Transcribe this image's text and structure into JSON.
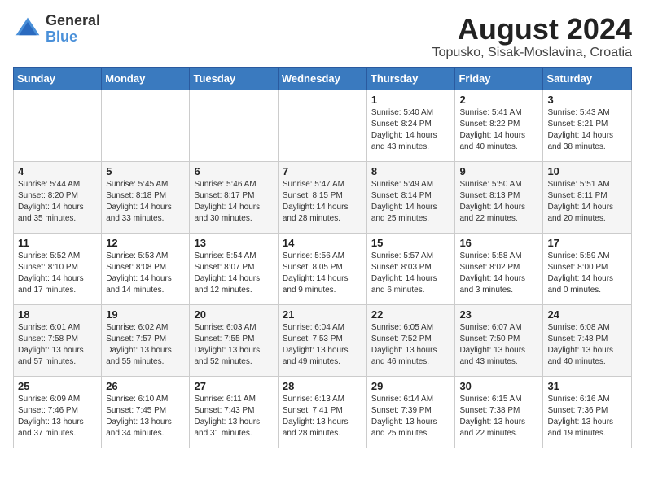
{
  "logo": {
    "general": "General",
    "blue": "Blue"
  },
  "title": {
    "month_year": "August 2024",
    "location": "Topusko, Sisak-Moslavina, Croatia"
  },
  "headers": [
    "Sunday",
    "Monday",
    "Tuesday",
    "Wednesday",
    "Thursday",
    "Friday",
    "Saturday"
  ],
  "weeks": [
    [
      {
        "day": "",
        "info": ""
      },
      {
        "day": "",
        "info": ""
      },
      {
        "day": "",
        "info": ""
      },
      {
        "day": "",
        "info": ""
      },
      {
        "day": "1",
        "info": "Sunrise: 5:40 AM\nSunset: 8:24 PM\nDaylight: 14 hours\nand 43 minutes."
      },
      {
        "day": "2",
        "info": "Sunrise: 5:41 AM\nSunset: 8:22 PM\nDaylight: 14 hours\nand 40 minutes."
      },
      {
        "day": "3",
        "info": "Sunrise: 5:43 AM\nSunset: 8:21 PM\nDaylight: 14 hours\nand 38 minutes."
      }
    ],
    [
      {
        "day": "4",
        "info": "Sunrise: 5:44 AM\nSunset: 8:20 PM\nDaylight: 14 hours\nand 35 minutes."
      },
      {
        "day": "5",
        "info": "Sunrise: 5:45 AM\nSunset: 8:18 PM\nDaylight: 14 hours\nand 33 minutes."
      },
      {
        "day": "6",
        "info": "Sunrise: 5:46 AM\nSunset: 8:17 PM\nDaylight: 14 hours\nand 30 minutes."
      },
      {
        "day": "7",
        "info": "Sunrise: 5:47 AM\nSunset: 8:15 PM\nDaylight: 14 hours\nand 28 minutes."
      },
      {
        "day": "8",
        "info": "Sunrise: 5:49 AM\nSunset: 8:14 PM\nDaylight: 14 hours\nand 25 minutes."
      },
      {
        "day": "9",
        "info": "Sunrise: 5:50 AM\nSunset: 8:13 PM\nDaylight: 14 hours\nand 22 minutes."
      },
      {
        "day": "10",
        "info": "Sunrise: 5:51 AM\nSunset: 8:11 PM\nDaylight: 14 hours\nand 20 minutes."
      }
    ],
    [
      {
        "day": "11",
        "info": "Sunrise: 5:52 AM\nSunset: 8:10 PM\nDaylight: 14 hours\nand 17 minutes."
      },
      {
        "day": "12",
        "info": "Sunrise: 5:53 AM\nSunset: 8:08 PM\nDaylight: 14 hours\nand 14 minutes."
      },
      {
        "day": "13",
        "info": "Sunrise: 5:54 AM\nSunset: 8:07 PM\nDaylight: 14 hours\nand 12 minutes."
      },
      {
        "day": "14",
        "info": "Sunrise: 5:56 AM\nSunset: 8:05 PM\nDaylight: 14 hours\nand 9 minutes."
      },
      {
        "day": "15",
        "info": "Sunrise: 5:57 AM\nSunset: 8:03 PM\nDaylight: 14 hours\nand 6 minutes."
      },
      {
        "day": "16",
        "info": "Sunrise: 5:58 AM\nSunset: 8:02 PM\nDaylight: 14 hours\nand 3 minutes."
      },
      {
        "day": "17",
        "info": "Sunrise: 5:59 AM\nSunset: 8:00 PM\nDaylight: 14 hours\nand 0 minutes."
      }
    ],
    [
      {
        "day": "18",
        "info": "Sunrise: 6:01 AM\nSunset: 7:58 PM\nDaylight: 13 hours\nand 57 minutes."
      },
      {
        "day": "19",
        "info": "Sunrise: 6:02 AM\nSunset: 7:57 PM\nDaylight: 13 hours\nand 55 minutes."
      },
      {
        "day": "20",
        "info": "Sunrise: 6:03 AM\nSunset: 7:55 PM\nDaylight: 13 hours\nand 52 minutes."
      },
      {
        "day": "21",
        "info": "Sunrise: 6:04 AM\nSunset: 7:53 PM\nDaylight: 13 hours\nand 49 minutes."
      },
      {
        "day": "22",
        "info": "Sunrise: 6:05 AM\nSunset: 7:52 PM\nDaylight: 13 hours\nand 46 minutes."
      },
      {
        "day": "23",
        "info": "Sunrise: 6:07 AM\nSunset: 7:50 PM\nDaylight: 13 hours\nand 43 minutes."
      },
      {
        "day": "24",
        "info": "Sunrise: 6:08 AM\nSunset: 7:48 PM\nDaylight: 13 hours\nand 40 minutes."
      }
    ],
    [
      {
        "day": "25",
        "info": "Sunrise: 6:09 AM\nSunset: 7:46 PM\nDaylight: 13 hours\nand 37 minutes."
      },
      {
        "day": "26",
        "info": "Sunrise: 6:10 AM\nSunset: 7:45 PM\nDaylight: 13 hours\nand 34 minutes."
      },
      {
        "day": "27",
        "info": "Sunrise: 6:11 AM\nSunset: 7:43 PM\nDaylight: 13 hours\nand 31 minutes."
      },
      {
        "day": "28",
        "info": "Sunrise: 6:13 AM\nSunset: 7:41 PM\nDaylight: 13 hours\nand 28 minutes."
      },
      {
        "day": "29",
        "info": "Sunrise: 6:14 AM\nSunset: 7:39 PM\nDaylight: 13 hours\nand 25 minutes."
      },
      {
        "day": "30",
        "info": "Sunrise: 6:15 AM\nSunset: 7:38 PM\nDaylight: 13 hours\nand 22 minutes."
      },
      {
        "day": "31",
        "info": "Sunrise: 6:16 AM\nSunset: 7:36 PM\nDaylight: 13 hours\nand 19 minutes."
      }
    ]
  ]
}
